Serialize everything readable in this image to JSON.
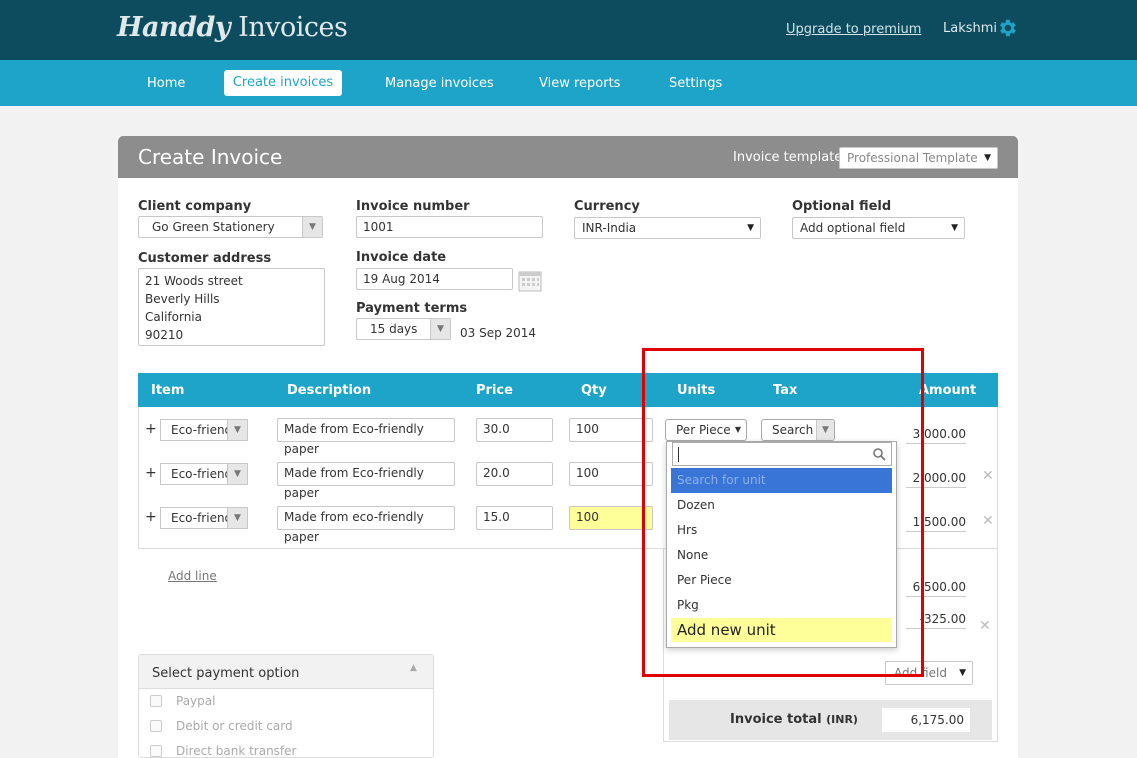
{
  "app": {
    "logo_script": "Handdy",
    "logo_text": " Invoices",
    "upgrade_link": "Upgrade to premium",
    "user_name": "Lakshmi"
  },
  "nav": {
    "items": [
      {
        "label": "Home"
      },
      {
        "label": "Create invoices",
        "active": true
      },
      {
        "label": "Manage invoices"
      },
      {
        "label": "View reports"
      },
      {
        "label": "Settings"
      }
    ]
  },
  "page": {
    "title": "Create Invoice",
    "template_label": "Invoice template",
    "template_value": "Professional Template"
  },
  "form": {
    "client_company_label": "Client company",
    "client_company_value": "Go Green Stationery",
    "customer_address_label": "Customer address",
    "customer_address_lines": [
      "21 Woods street",
      "Beverly Hills",
      "California",
      "90210"
    ],
    "invoice_number_label": "Invoice number",
    "invoice_number_value": "1001",
    "invoice_date_label": "Invoice date",
    "invoice_date_value": "19 Aug 2014",
    "payment_terms_label": "Payment terms",
    "payment_terms_value": "15 days",
    "due_date": "03 Sep 2014",
    "currency_label": "Currency",
    "currency_value": "INR-India",
    "optional_field_label": "Optional field",
    "optional_field_value": "Add optional field"
  },
  "table": {
    "headers": {
      "item": "Item",
      "description": "Description",
      "price": "Price",
      "qty": "Qty",
      "units": "Units",
      "tax": "Tax",
      "amount": "Amount"
    },
    "rows": [
      {
        "item": "Eco-friendly",
        "description": "Made from Eco-friendly paper",
        "price": "30.0",
        "qty": "100",
        "amount": "3,000.00"
      },
      {
        "item": "Eco-friendly",
        "description": "Made from Eco-friendly paper",
        "price": "20.0",
        "qty": "100",
        "amount": "2,000.00"
      },
      {
        "item": "Eco-friendly",
        "description": "Made from eco-friendly paper",
        "price": "15.0",
        "qty": "100",
        "amount": "1,500.00"
      }
    ],
    "units_value": "Per Piece",
    "tax_value": "Search",
    "add_line": "Add line"
  },
  "units_dropdown": {
    "search_placeholder": "",
    "options": [
      "Search for unit",
      "Dozen",
      "Hrs",
      "None",
      "Per Piece",
      "Pkg",
      "Add new unit"
    ]
  },
  "totals": {
    "subtotal": "6,500.00",
    "tax_amount": "-325.00",
    "add_field": "Add field",
    "total_label": "Invoice total",
    "total_currency": "(INR)",
    "total_value": "6,175.00"
  },
  "payment": {
    "header": "Select payment option",
    "options": [
      "Paypal",
      "Debit or credit card",
      "Direct bank transfer"
    ]
  },
  "colors": {
    "topbar": "#0d4c5e",
    "navbar": "#1ea4c8",
    "header_bar": "#8d8d8d",
    "highlight": "#ffff99",
    "selected_option": "#3875d7",
    "annotation": "#e00000"
  }
}
